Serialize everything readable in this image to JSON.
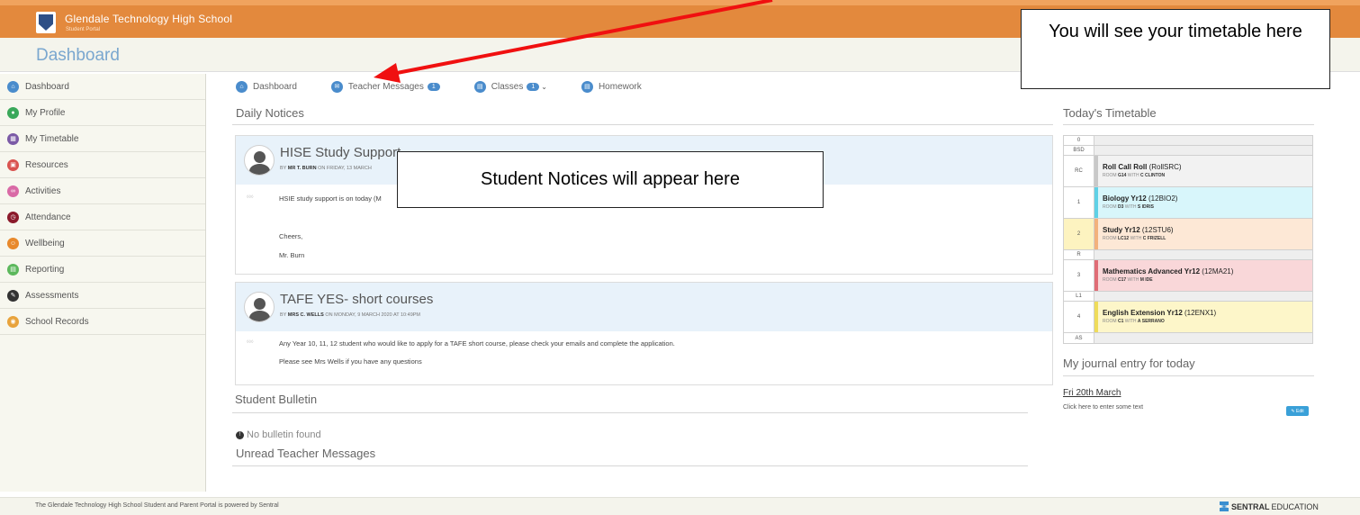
{
  "header": {
    "school_name": "Glendale Technology High School",
    "portal_name": "Student Portal",
    "page_title": "Dashboard"
  },
  "sidebar": {
    "items": [
      {
        "label": "Dashboard",
        "icon": "home-icon",
        "color": "#4a8ccc"
      },
      {
        "label": "My Profile",
        "icon": "user-icon",
        "color": "#3aa85a"
      },
      {
        "label": "My Timetable",
        "icon": "calendar-icon",
        "color": "#7b5aa6"
      },
      {
        "label": "Resources",
        "icon": "book-icon",
        "color": "#d9534f"
      },
      {
        "label": "Activities",
        "icon": "bike-icon",
        "color": "#d96aa6"
      },
      {
        "label": "Attendance",
        "icon": "clock-icon",
        "color": "#8b1a2b"
      },
      {
        "label": "Wellbeing",
        "icon": "smile-icon",
        "color": "#e8892c"
      },
      {
        "label": "Reporting",
        "icon": "chart-icon",
        "color": "#5cb85c"
      },
      {
        "label": "Assessments",
        "icon": "pencil-icon",
        "color": "#333333"
      },
      {
        "label": "School Records",
        "icon": "folder-icon",
        "color": "#e8a33c"
      }
    ]
  },
  "tabs": {
    "dashboard": "Dashboard",
    "teacher_messages": "Teacher Messages",
    "teacher_messages_count": "1",
    "classes": "Classes",
    "classes_count": "1",
    "homework": "Homework"
  },
  "daily_notices": {
    "heading": "Daily Notices",
    "notices": [
      {
        "title": "HISE Study Support",
        "by_prefix": "BY",
        "author": "MR T. BURN",
        "posted": "ON FRIDAY, 13 MARCH",
        "lines": [
          "HSIE study support is on today (M",
          "Cheers,",
          "Mr. Burn"
        ]
      },
      {
        "title": "TAFE YES- short courses",
        "by_prefix": "BY",
        "author": "MRS C. WELLS",
        "posted": "ON MONDAY, 9 MARCH 2020 AT 10:49PM",
        "lines": [
          "Any Year 10, 11, 12 student who would like to apply for a TAFE short course, please check your emails and complete the application.",
          "Please see Mrs Wells if you have any questions"
        ]
      }
    ]
  },
  "student_bulletin": {
    "heading": "Student Bulletin",
    "empty_text": "No bulletin found"
  },
  "unread_messages": {
    "heading": "Unread Teacher Messages"
  },
  "timetable": {
    "heading": "Today's Timetable",
    "rows": [
      {
        "period": "0"
      },
      {
        "period": "BSD"
      },
      {
        "period": "RC",
        "subject": "Roll Call Roll",
        "code": "(RollSRC)",
        "room_prefix": "ROOM",
        "room": "G14",
        "with": "WITH",
        "teacher": "C CLINTON",
        "color": "#f2f2f2",
        "bar": "#c8c8c8"
      },
      {
        "period": "1",
        "subject": "Biology Yr12",
        "code": "(12BIO2)",
        "room_prefix": "ROOM",
        "room": "D3",
        "with": "WITH",
        "teacher": "S IDRIS",
        "color": "#d8f6fb",
        "bar": "#5fd1e6"
      },
      {
        "period": "2",
        "subject": "Study Yr12",
        "code": "(12STU6)",
        "room_prefix": "ROOM",
        "room": "LC12",
        "with": "WITH",
        "teacher": "C FRIZELL",
        "color": "#fde8d6",
        "bar": "#f3b27c"
      },
      {
        "period": "R"
      },
      {
        "period": "3",
        "subject": "Mathematics Advanced Yr12",
        "code": "(12MA21)",
        "room_prefix": "ROOM",
        "room": "C17",
        "with": "WITH",
        "teacher": "M IDE",
        "color": "#f9d7d9",
        "bar": "#e06d76"
      },
      {
        "period": "L1"
      },
      {
        "period": "4",
        "subject": "English Extension Yr12",
        "code": "(12ENX1)",
        "room_prefix": "ROOM",
        "room": "C1",
        "with": "WITH",
        "teacher": "A SERRANO",
        "color": "#fdf6c9",
        "bar": "#efdc5a"
      },
      {
        "period": "AS"
      }
    ]
  },
  "journal": {
    "heading": "My journal entry for today",
    "date": "Fri 20th March",
    "hint": "Click here to enter some text",
    "edit_label": "Edit"
  },
  "callouts": {
    "timetable": "You will see your timetable here",
    "notices": "Student Notices will appear here"
  },
  "footer": {
    "text": "The Glendale Technology High School Student and Parent Portal is powered by Sentral",
    "brand_bold": "SENTRAL",
    "brand_thin": "EDUCATION"
  }
}
